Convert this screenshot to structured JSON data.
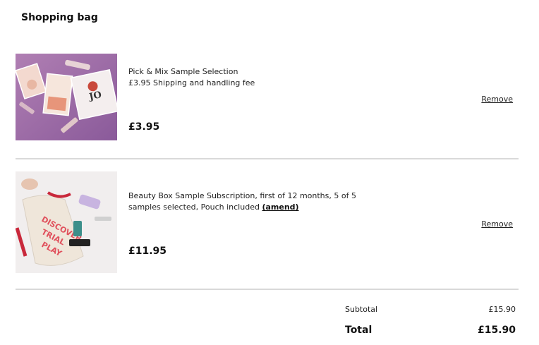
{
  "bag": {
    "title": "Shopping bag"
  },
  "items": [
    {
      "image_icon": "sample-sachets-image",
      "description": "Pick & Mix Sample Selection\n£3.95 Shipping and handling fee",
      "price": "£3.95",
      "remove_label": "Remove"
    },
    {
      "image_icon": "beauty-box-pouch-image",
      "description_prefix": "Beauty Box Sample Subscription, first of 12 months, 5 of 5 samples selected, Pouch included ",
      "amend_label": "(amend)",
      "price": "£11.95",
      "remove_label": "Remove"
    }
  ],
  "summary": {
    "subtotal_label": "Subtotal",
    "subtotal_value": "£15.90",
    "total_label": "Total",
    "total_value": "£15.90"
  }
}
